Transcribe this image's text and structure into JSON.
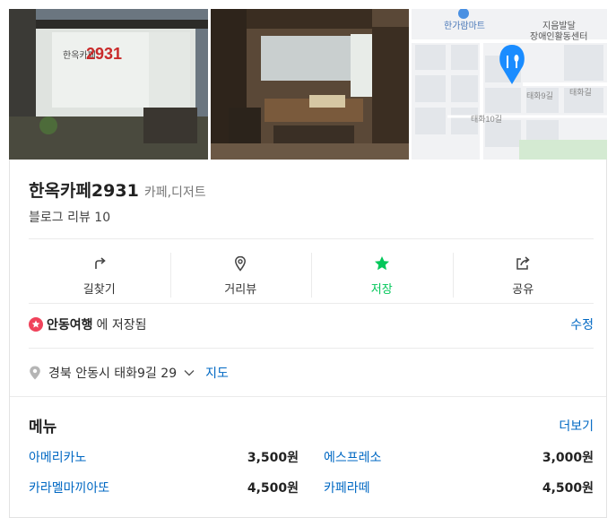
{
  "place": {
    "name": "한옥카페2931",
    "category": "카페,디저트",
    "review_text": "블로그 리뷰 10"
  },
  "photos": {
    "sign_text": "2931",
    "sign_prefix": "한옥카페"
  },
  "map": {
    "labels": [
      "한가람마트",
      "지음발달",
      "장애인활동센터",
      "태화9길",
      "태화길",
      "태화10길"
    ]
  },
  "actions": [
    {
      "label": "길찾기",
      "icon": "directions-icon"
    },
    {
      "label": "거리뷰",
      "icon": "location-pin-icon"
    },
    {
      "label": "저장",
      "icon": "star-icon"
    },
    {
      "label": "공유",
      "icon": "share-icon"
    }
  ],
  "saved": {
    "folder": "안동여행",
    "suffix": "에 저장됨",
    "edit_label": "수정"
  },
  "address": {
    "text": "경북 안동시 태화9길 29",
    "map_label": "지도"
  },
  "menu": {
    "title": "메뉴",
    "more_label": "더보기",
    "items": [
      {
        "name": "아메리카노",
        "price": "3,500원"
      },
      {
        "name": "에스프레소",
        "price": "3,000원"
      },
      {
        "name": "카라멜마끼아또",
        "price": "4,500원"
      },
      {
        "name": "카페라떼",
        "price": "4,500원"
      }
    ]
  },
  "colors": {
    "accent_green": "#03c75a",
    "link_blue": "#0068c3",
    "map_pin_blue": "#1a8cff",
    "saved_badge_red": "#f0435b"
  }
}
